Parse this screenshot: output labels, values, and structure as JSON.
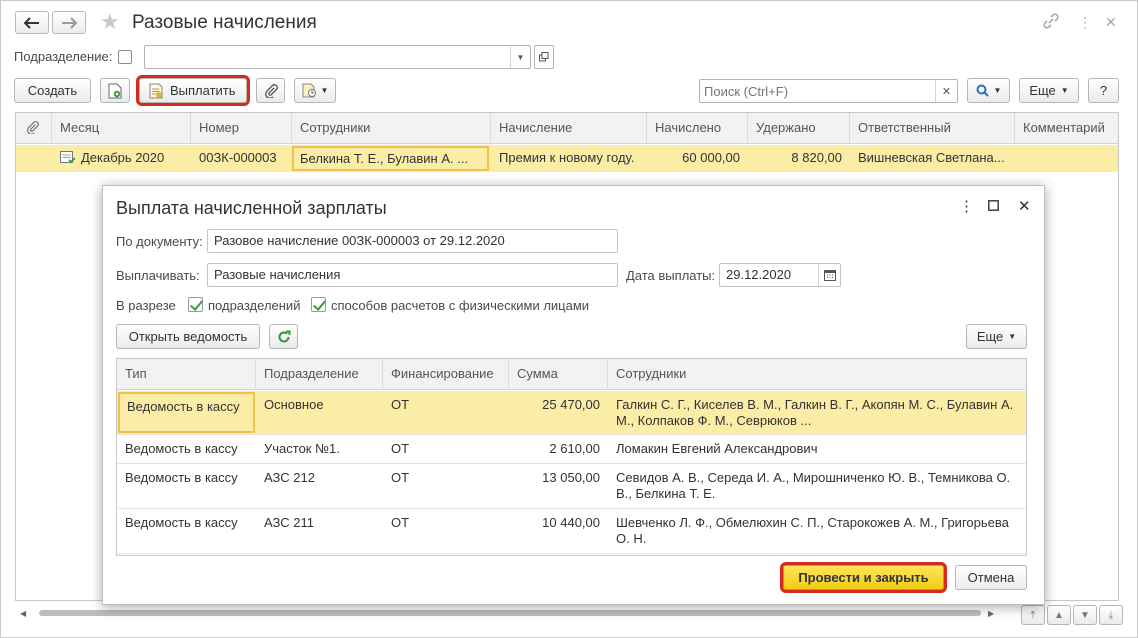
{
  "window": {
    "title": "Разовые начисления"
  },
  "filter": {
    "label": "Подразделение:",
    "value": ""
  },
  "toolbar": {
    "create_label": "Создать",
    "pay_label": "Выплатить",
    "search_placeholder": "Поиск (Ctrl+F)",
    "more_label": "Еще",
    "help_label": "?"
  },
  "table": {
    "columns": [
      "Месяц",
      "Номер",
      "Сотрудники",
      "Начисление",
      "Начислено",
      "Удержано",
      "Ответственный",
      "Комментарий"
    ],
    "rows": [
      {
        "month": "Декабрь 2020",
        "number": "00ЗК-000003",
        "employees": "Белкина Т. Е., Булавин А. ...",
        "accrual": "Премия к новому году.",
        "accrued": "60 000,00",
        "withheld": "8 820,00",
        "responsible": "Вишневская Светлана...",
        "comment": ""
      }
    ]
  },
  "dialog": {
    "title": "Выплата начисленной зарплаты",
    "doc_label": "По документу:",
    "doc_value": "Разовое начисление 00ЗК-000003 от 29.12.2020",
    "pay_label": "Выплачивать:",
    "pay_value": "Разовые начисления",
    "date_label": "Дата выплаты:",
    "date_value": "29.12.2020",
    "section_label": "В разрезе",
    "check1_label": "подразделений",
    "check2_label": "способов расчетов с физическими лицами",
    "open_button": "Открыть ведомость",
    "more_label": "Еще",
    "columns": [
      "Тип",
      "Подразделение",
      "Финансирование",
      "Сумма",
      "Сотрудники"
    ],
    "rows": [
      {
        "type": "Ведомость в кассу",
        "division": "Основное",
        "financing": "ОТ",
        "sum": "25 470,00",
        "employees": "Галкин С. Г., Киселев В. М., Галкин В. Г., Акопян М. С., Булавин А. М., Колпаков Ф. М., Севрюков ..."
      },
      {
        "type": "Ведомость в кассу",
        "division": "Участок №1.",
        "financing": "ОТ",
        "sum": "2 610,00",
        "employees": "Ломакин Евгений Александрович"
      },
      {
        "type": "Ведомость в кассу",
        "division": "АЗС 212",
        "financing": "ОТ",
        "sum": "13 050,00",
        "employees": "Севидов А. В., Середа И. А., Мирошниченко Ю. В., Темникова О. В., Белкина Т. Е."
      },
      {
        "type": "Ведомость в кассу",
        "division": "АЗС 211",
        "financing": "ОТ",
        "sum": "10 440,00",
        "employees": "Шевченко Л. Ф., Обмелюхин С. П., Старокожев А. М., Григорьева О. Н."
      }
    ],
    "post_close_label": "Провести и закрыть",
    "cancel_label": "Отмена"
  },
  "colors": {
    "highlight_row": "#fbeda6",
    "primary_button": "#f5d31c",
    "red_outline": "#d52b1e"
  }
}
